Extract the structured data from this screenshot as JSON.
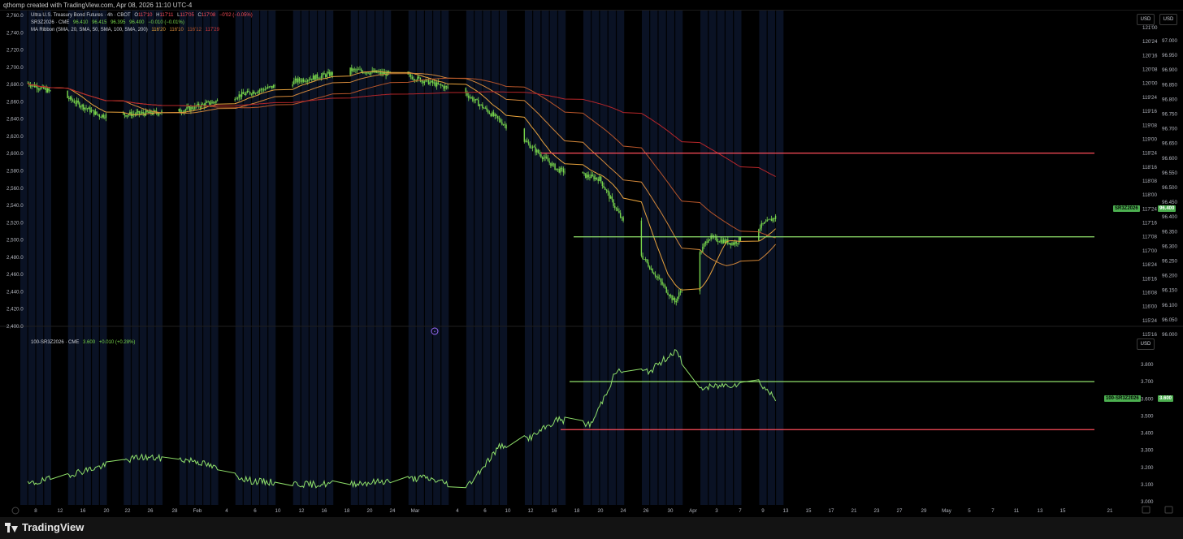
{
  "caption": "qthomp created with TradingView.com, Apr 08, 2026 11:10 UTC-4",
  "legend": {
    "line1": {
      "title": "Ultra U.S. Treasury Bond Futures · 4h · CBOT",
      "o_label": "O",
      "o": "117'10",
      "h_label": "H",
      "h": "117'11",
      "l_label": "L",
      "l": "117'05",
      "c_label": "C",
      "c": "117'08",
      "chg": "−0'02 (−0.05%)"
    },
    "line2": {
      "title": "SR3Z2026 · CME",
      "o": "96.410",
      "h": "96.415",
      "l": "96.395",
      "c": "96.400",
      "chg": "−0.010 (−0.01%)"
    },
    "line3": {
      "title": "MA Ribbon (SMA, 20, SMA, 50, SMA, 100, SMA, 200)",
      "v1": "116'20",
      "v2": "116'10",
      "v3": "116'12",
      "v4": "117'29"
    },
    "lower": {
      "title": "100-SR3Z2026 · CME",
      "value": "3.600",
      "chg": "+0.010 (+0.28%)"
    }
  },
  "buttons": {
    "usd1": "USD",
    "usd2": "USD",
    "usd3": "USD"
  },
  "tags": {
    "upper_symbol": "SR3Z2026",
    "upper_value": "96.400",
    "lower_symbol": "100-SR3Z2026",
    "lower_value": "3.600"
  },
  "logo": "TradingView",
  "colors": {
    "bull": "#78d64b",
    "line_green": "#8fe06a",
    "red_line": "#ff4d5a",
    "ma20": "#e8a33c",
    "ma50": "#d2873a",
    "ma100": "#b8552a",
    "ma200": "#b8262a",
    "bg_session": "#0b1428"
  },
  "chart_data": [
    {
      "type": "line",
      "title": "Ultra U.S. Treasury Bond Futures · 4h · CBOT",
      "left_axis_ticks": [
        "2,760.0",
        "2,740.0",
        "2,720.0",
        "2,700.0",
        "2,680.0",
        "2,660.0",
        "2,640.0",
        "2,620.0",
        "2,600.0",
        "2,580.0",
        "2,560.0",
        "2,540.0",
        "2,520.0",
        "2,500.0",
        "2,480.0",
        "2,460.0",
        "2,440.0",
        "2,420.0",
        "2,400.0"
      ],
      "right_axis1_ticks": [
        "121'00",
        "120'24",
        "120'16",
        "120'08",
        "120'00",
        "119'24",
        "119'16",
        "119'08",
        "119'00",
        "118'24",
        "118'16",
        "118'08",
        "118'00",
        "117'24",
        "117'16",
        "117'08",
        "117'00",
        "116'24",
        "116'16",
        "116'08",
        "116'00",
        "115'24",
        "115'16"
      ],
      "right_axis2_ticks": [
        "97.000",
        "96.950",
        "96.900",
        "96.850",
        "96.800",
        "96.750",
        "96.700",
        "96.650",
        "96.600",
        "96.550",
        "96.500",
        "96.450",
        "96.400",
        "96.350",
        "96.300",
        "96.250",
        "96.200",
        "96.150",
        "96.100",
        "96.050",
        "96.000"
      ],
      "x_ticks": [
        "8",
        "12",
        "16",
        "20",
        "22",
        "26",
        "28",
        "Feb",
        "4",
        "6",
        "10",
        "12",
        "16",
        "18",
        "20",
        "24",
        "Mar",
        "4",
        "6",
        "10",
        "12",
        "16",
        "18",
        "20",
        "24",
        "26",
        "30",
        "Apr",
        "3",
        "7",
        "9",
        "13",
        "15",
        "17",
        "21",
        "23",
        "27",
        "29",
        "May",
        "5",
        "7",
        "11",
        "13",
        "15",
        "21"
      ],
      "series": [
        {
          "name": "SR3Z2026",
          "x": [
            "Jan 7",
            "Jan 12",
            "Jan 16",
            "Jan 20",
            "Jan 26",
            "Feb 2",
            "Feb 9",
            "Feb 16",
            "Feb 23",
            "Mar 2",
            "Mar 9",
            "Mar 13",
            "Mar 18",
            "Mar 23",
            "Mar 27",
            "Mar 31",
            "Apr 3",
            "Apr 8"
          ],
          "values": [
            96.855,
            96.805,
            96.745,
            96.75,
            96.76,
            96.81,
            96.86,
            96.9,
            96.88,
            96.82,
            96.66,
            96.56,
            96.53,
            96.27,
            96.11,
            96.33,
            96.31,
            96.4
          ]
        },
        {
          "name": "100-SR3Z2026",
          "x": [
            "Jan 7",
            "Jan 14",
            "Jan 21",
            "Jan 28",
            "Feb 4",
            "Feb 11",
            "Feb 18",
            "Feb 25",
            "Mar 2",
            "Mar 6",
            "Mar 10",
            "Mar 13",
            "Mar 17",
            "Mar 20",
            "Mar 24",
            "Mar 27",
            "Mar 30",
            "Apr 2",
            "Apr 6",
            "Apr 8"
          ],
          "values": [
            3.1,
            3.18,
            3.26,
            3.24,
            3.12,
            3.1,
            3.11,
            3.14,
            3.08,
            3.32,
            3.38,
            3.48,
            3.45,
            3.76,
            3.76,
            3.88,
            3.66,
            3.68,
            3.7,
            3.6
          ]
        }
      ],
      "horizontal_lines": [
        {
          "price": "118'24",
          "color": "red"
        },
        {
          "price": "117'08",
          "color": "green"
        },
        {
          "price": 3.7,
          "color": "green"
        },
        {
          "price": 3.42,
          "color": "red"
        }
      ],
      "lower_axis_ticks": [
        "3.800",
        "3.700",
        "3.600",
        "3.500",
        "3.400",
        "3.300",
        "3.200",
        "3.100",
        "3.000"
      ]
    }
  ]
}
